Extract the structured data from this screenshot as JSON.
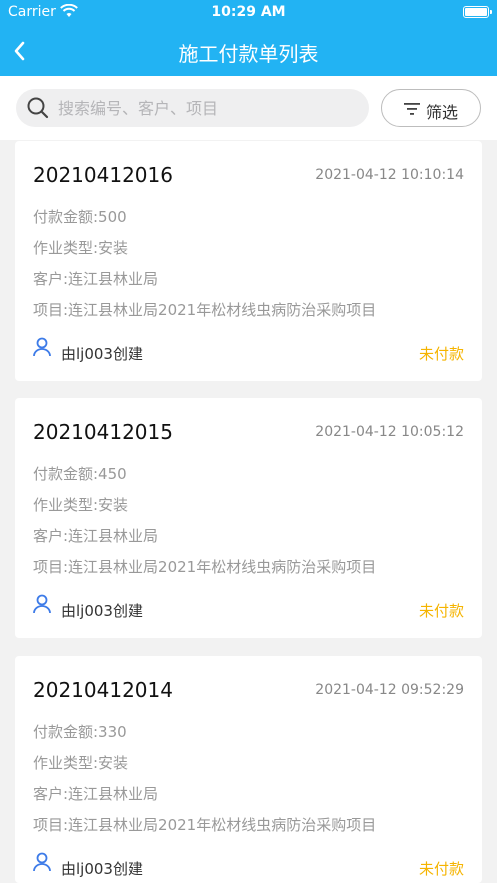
{
  "status_bar": {
    "carrier": "Carrier",
    "time": "10:29 AM"
  },
  "nav": {
    "title": "施工付款单列表",
    "back_icon": "chevron-left-icon"
  },
  "search": {
    "placeholder": "搜索编号、客户、项目",
    "value": ""
  },
  "filter": {
    "label": "筛选",
    "icon": "filter-icon"
  },
  "colors": {
    "brand": "#22b3f3",
    "unpaid": "#f5b400",
    "user_icon": "#3d7be8"
  },
  "orders": [
    {
      "number": "20210412016",
      "datetime": "2021-04-12 10:10:14",
      "amount": "付款金额:500",
      "work_type": "作业类型:安装",
      "customer": "客户:连江县林业局",
      "project": "项目:连江县林业局2021年松材线虫病防治采购项目",
      "creator": "由lj003创建",
      "status": "未付款"
    },
    {
      "number": "20210412015",
      "datetime": "2021-04-12 10:05:12",
      "amount": "付款金额:450",
      "work_type": "作业类型:安装",
      "customer": "客户:连江县林业局",
      "project": "项目:连江县林业局2021年松材线虫病防治采购项目",
      "creator": "由lj003创建",
      "status": "未付款"
    },
    {
      "number": "20210412014",
      "datetime": "2021-04-12 09:52:29",
      "amount": "付款金额:330",
      "work_type": "作业类型:安装",
      "customer": "客户:连江县林业局",
      "project": "项目:连江县林业局2021年松材线虫病防治采购项目",
      "creator": "由lj003创建",
      "status": "未付款"
    }
  ]
}
